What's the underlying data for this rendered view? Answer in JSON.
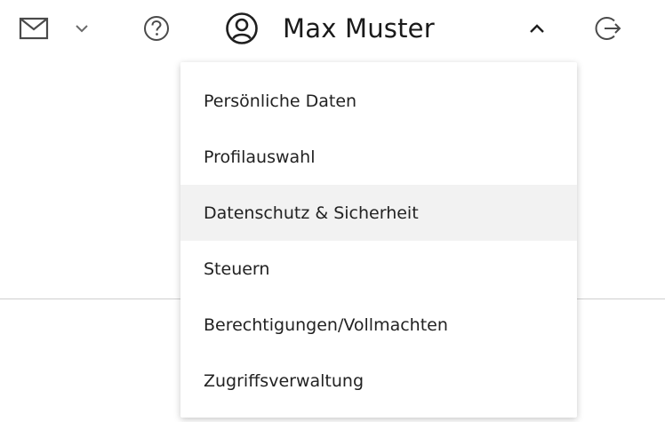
{
  "header": {
    "mail_icon": "mail-icon",
    "mail_menu_icon": "chevron-down-icon",
    "help_icon": "help-circle-icon",
    "user": {
      "icon": "user-circle-icon",
      "name": "Max Muster",
      "menu_state_icon": "chevron-up-icon"
    },
    "logout_icon": "logout-icon"
  },
  "user_menu": {
    "items": [
      {
        "label": "Persönliche Daten"
      },
      {
        "label": "Profilauswahl"
      },
      {
        "label": "Datenschutz & Sicherheit",
        "highlighted": true
      },
      {
        "label": "Steuern"
      },
      {
        "label": "Berechtigungen/Vollmachten"
      },
      {
        "label": "Zugriffsverwaltung"
      }
    ]
  },
  "colors": {
    "icon": "#4a4a4a",
    "text": "#1f1f1f",
    "highlight": "#f2f2f2",
    "divider": "#cfcfcf"
  }
}
